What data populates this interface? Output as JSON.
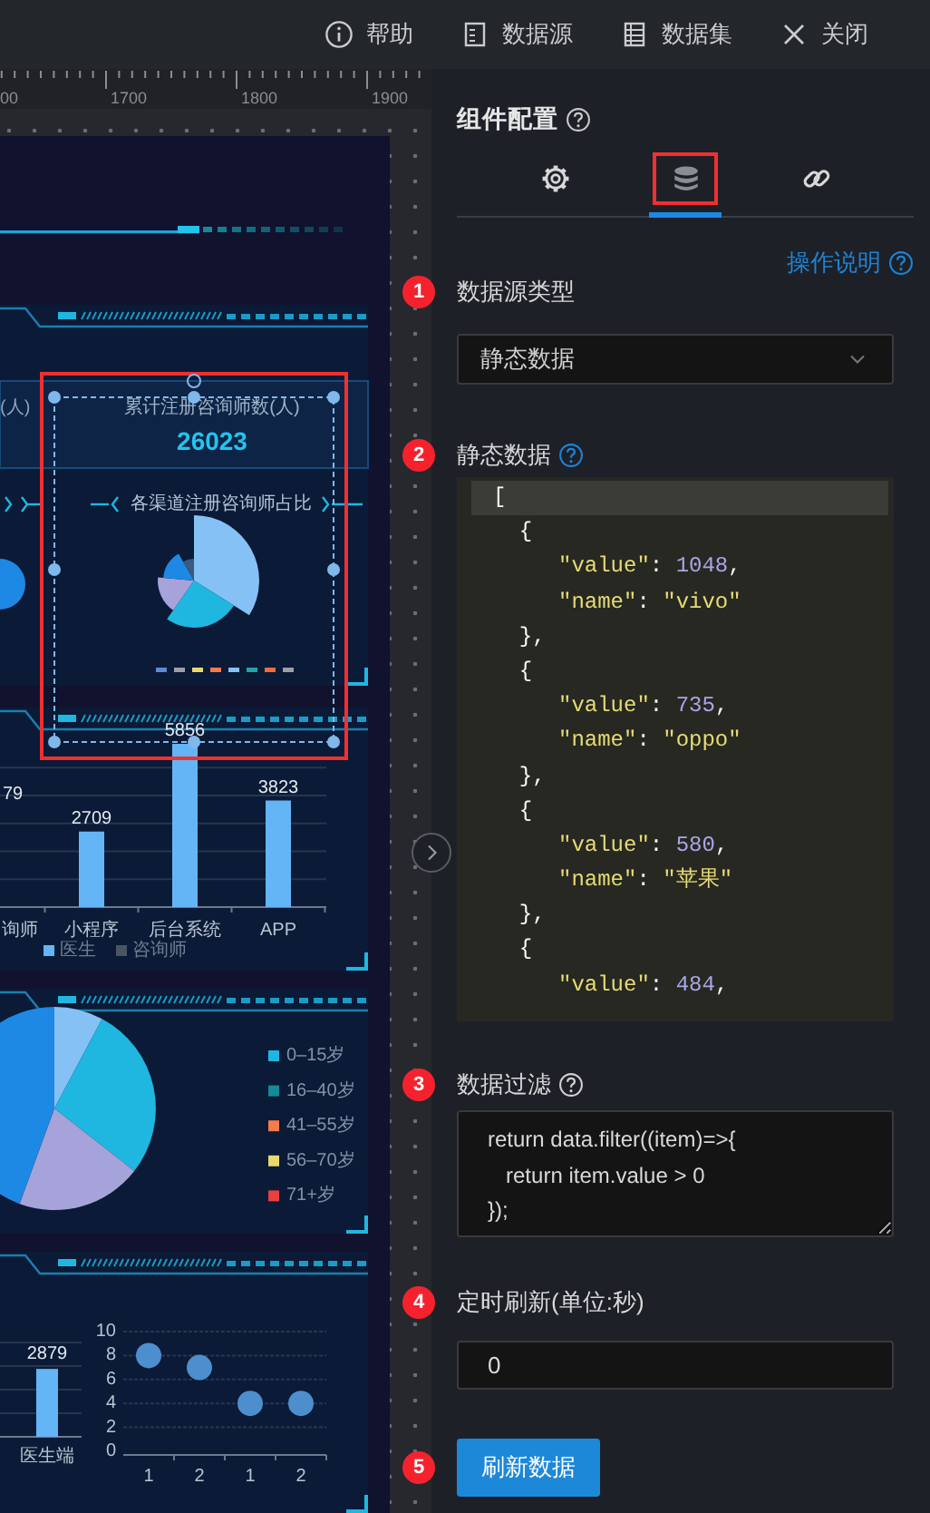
{
  "toolbar": [
    {
      "kind": "info",
      "label": "帮助"
    },
    {
      "kind": "list",
      "label": "数据源"
    },
    {
      "kind": "table",
      "label": "数据集"
    },
    {
      "kind": "close",
      "label": "关闭"
    }
  ],
  "ruler": {
    "labels": [
      "00",
      "1700",
      "1800",
      "1900"
    ]
  },
  "canvas": {
    "kpi_widget": {
      "selected": true,
      "side_label": "(人)",
      "title": "累计注册咨询师数(人)",
      "value": "26023",
      "subtitle": "各渠道注册咨询师占比"
    },
    "channel_widget": {
      "chart_data": {
        "type": "bar",
        "categories": [
          "询师",
          "小程序",
          "后台系统",
          "APP"
        ],
        "values": [
          null,
          2709,
          5856,
          3823
        ],
        "value_labels": [
          "79",
          "2709",
          "5856",
          "3823"
        ],
        "grid": true,
        "ylim": [
          0,
          6000
        ]
      },
      "legend": [
        {
          "label": "医生",
          "color": "#64b5f6"
        },
        {
          "label": "咨询师",
          "color": "#4a5562"
        }
      ]
    },
    "age_widget": {
      "legend": [
        {
          "label": "0–15岁",
          "color": "#1fb5e3"
        },
        {
          "label": "16–40岁",
          "color": "#138a96"
        },
        {
          "label": "41–55岁",
          "color": "#f47b4b"
        },
        {
          "label": "56–70岁",
          "color": "#e8d86f"
        },
        {
          "label": "71+岁",
          "color": "#e94040"
        }
      ]
    },
    "bottom_widget": {
      "bar": {
        "chart_data": {
          "type": "bar",
          "categories": [
            "医生端"
          ],
          "values": [
            2879
          ],
          "data_labels": true,
          "grid": true
        }
      },
      "scatter": {
        "chart_data": {
          "type": "scatter",
          "categories": [
            "1",
            "2",
            "1",
            "2"
          ],
          "values": [
            8,
            7,
            4,
            4
          ],
          "ylim": [
            0,
            10
          ],
          "yticks": [
            0,
            2,
            4,
            6,
            8,
            10
          ],
          "grid": true
        }
      }
    }
  },
  "panel": {
    "title": "组件配置",
    "tabs": [
      {
        "kind": "settings",
        "selected": false
      },
      {
        "kind": "data",
        "selected": true
      },
      {
        "kind": "link",
        "selected": false
      }
    ],
    "help_link": "操作说明",
    "steps": [
      {
        "number": "1",
        "kind": "select",
        "label": "数据源类型",
        "value": "静态数据"
      },
      {
        "number": "2",
        "kind": "code",
        "label": "静态数据",
        "help": {
          "color": "#1d84d6"
        },
        "lines": [
          {
            "active": true,
            "segments": [
              {
                "kind": "punct",
                "text": "["
              }
            ]
          },
          {
            "active": false,
            "segments": [
              {
                "kind": "punct",
                "text": "  {"
              }
            ]
          },
          {
            "active": false,
            "segments": [
              {
                "kind": "string",
                "text": "     \"value\""
              },
              {
                "kind": "punct",
                "text": ": "
              },
              {
                "kind": "number",
                "text": "1048"
              },
              {
                "kind": "punct",
                "text": ","
              }
            ]
          },
          {
            "active": false,
            "segments": [
              {
                "kind": "string",
                "text": "     \"name\""
              },
              {
                "kind": "punct",
                "text": ": "
              },
              {
                "kind": "string",
                "text": "\"vivo\""
              }
            ]
          },
          {
            "active": false,
            "segments": [
              {
                "kind": "punct",
                "text": "  },"
              }
            ]
          },
          {
            "active": false,
            "segments": [
              {
                "kind": "punct",
                "text": "  {"
              }
            ]
          },
          {
            "active": false,
            "segments": [
              {
                "kind": "string",
                "text": "     \"value\""
              },
              {
                "kind": "punct",
                "text": ": "
              },
              {
                "kind": "number",
                "text": "735"
              },
              {
                "kind": "punct",
                "text": ","
              }
            ]
          },
          {
            "active": false,
            "segments": [
              {
                "kind": "string",
                "text": "     \"name\""
              },
              {
                "kind": "punct",
                "text": ": "
              },
              {
                "kind": "string",
                "text": "\"oppo\""
              }
            ]
          },
          {
            "active": false,
            "segments": [
              {
                "kind": "punct",
                "text": "  },"
              }
            ]
          },
          {
            "active": false,
            "segments": [
              {
                "kind": "punct",
                "text": "  {"
              }
            ]
          },
          {
            "active": false,
            "segments": [
              {
                "kind": "string",
                "text": "     \"value\""
              },
              {
                "kind": "punct",
                "text": ": "
              },
              {
                "kind": "number",
                "text": "580"
              },
              {
                "kind": "punct",
                "text": ","
              }
            ]
          },
          {
            "active": false,
            "segments": [
              {
                "kind": "string",
                "text": "     \"name\""
              },
              {
                "kind": "punct",
                "text": ": "
              },
              {
                "kind": "string",
                "text": "\"苹果\""
              }
            ]
          },
          {
            "active": false,
            "segments": [
              {
                "kind": "punct",
                "text": "  },"
              }
            ]
          },
          {
            "active": false,
            "segments": [
              {
                "kind": "punct",
                "text": "  {"
              }
            ]
          },
          {
            "active": false,
            "segments": [
              {
                "kind": "string",
                "text": "     \"value\""
              },
              {
                "kind": "punct",
                "text": ": "
              },
              {
                "kind": "number",
                "text": "484"
              },
              {
                "kind": "punct",
                "text": ","
              }
            ]
          }
        ]
      },
      {
        "number": "3",
        "kind": "textarea",
        "label": "数据过滤",
        "help": {
          "color": "#d0d0d0"
        },
        "lines": [
          "return data.filter((item)=>{",
          "   return item.value > 0",
          "});"
        ]
      },
      {
        "number": "4",
        "kind": "input",
        "label": "定时刷新(单位:秒)",
        "value": "0"
      },
      {
        "number": "5",
        "kind": "button",
        "label": "刷新数据"
      }
    ]
  }
}
